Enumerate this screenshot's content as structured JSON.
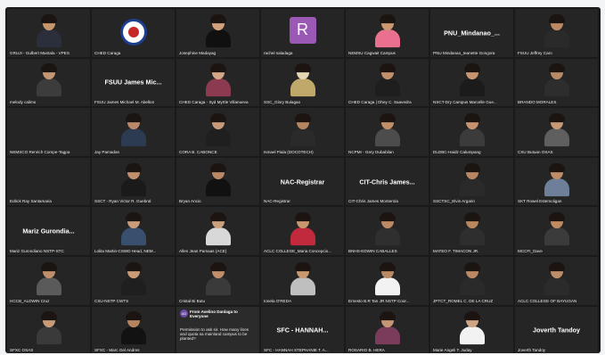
{
  "tiles": [
    {
      "name": "GRUJI - Gulbert Mantala - VPES",
      "bg": "#6a6d75",
      "skin": "#c8966c",
      "shirt": "#2b2f3b",
      "kind": "person"
    },
    {
      "name": "CHED Caraga",
      "kind": "logo"
    },
    {
      "name": "Josephine Madayag",
      "bg": "#d9dadf",
      "skin": "#d2a17c",
      "shirt": "#101010",
      "kind": "person"
    },
    {
      "name": "rachel saladaga",
      "kind": "letter",
      "letter": "R"
    },
    {
      "name": "NEMSU Cagwait Campus",
      "bg": "#8e7aa0",
      "skin": "#cb9871",
      "shirt": "#e9718f",
      "kind": "person"
    },
    {
      "name": "PNU Mindanao_Ieanette Gongora",
      "kind": "big",
      "big": "PNU_Mindanao_..."
    },
    {
      "name": "FSUU Jeffrey Caro",
      "bg": "#4a8f3d",
      "skin": "#bb8a64",
      "shirt": "#2a2a2a",
      "kind": "person"
    },
    {
      "name": "melody calimo",
      "bg": "#7b8dac",
      "skin": "#c49774",
      "shirt": "#3c3c3c",
      "kind": "person"
    },
    {
      "name": "FSUU James Michael M. Abellon",
      "kind": "big",
      "big": "FSUU James Mic..."
    },
    {
      "name": "CHED Caraga - Syd Myrtle Villanueva",
      "bg": "#e2d8c8",
      "skin": "#d4a786",
      "shirt": "#8b3a4f",
      "kind": "person"
    },
    {
      "name": "SSC_Glory Bulagao",
      "bg": "#66803b",
      "skin": "#e4d5b4",
      "shirt": "#c0a86a",
      "kind": "person"
    },
    {
      "name": "CHED Caraga | Dhey C. Saavedra",
      "bg": "#e4e4e4",
      "skin": "#c2906a",
      "shirt": "#1e1e1e",
      "kind": "person"
    },
    {
      "name": "NSCT-Dry Campus Marcelle Gue...",
      "bg": "#56a54e",
      "skin": "#c8956e",
      "shirt": "#1b1b1b",
      "kind": "person"
    },
    {
      "name": "BRANDO MORALES",
      "bg": "#dcdcdc",
      "skin": "#b98a66",
      "shirt": "#2d2d2d",
      "kind": "person"
    },
    {
      "name": "NEMSCO Renrich Compe-Tagpa",
      "kind": "black"
    },
    {
      "name": "Jay Pamadan",
      "bg": "#7b7f86",
      "skin": "#b9896a",
      "shirt": "#2c3a52",
      "kind": "person"
    },
    {
      "name": "CORA B. CABONCE",
      "bg": "#4d8f2f",
      "skin": "#c99a7a",
      "shirt": "#1f1f1f",
      "kind": "person"
    },
    {
      "name": "Ismael Piala (DOCOTECH)",
      "bg": "#c8a77b",
      "skin": "#b78460",
      "shirt": "#2a2a2a",
      "kind": "person"
    },
    {
      "name": "NCPMI - Gery Dubabilan",
      "bg": "#9a8b74",
      "skin": "#c08f68",
      "shirt": "#4c4c4c",
      "kind": "person"
    },
    {
      "name": "DLDBC-Haidz Calumpang",
      "bg": "#f1eeea",
      "skin": "#c7926d",
      "shirt": "#3b3b3b",
      "kind": "person"
    },
    {
      "name": "CSU Butuan OSAS",
      "bg": "#d7d3cf",
      "skin": "#c69a75",
      "shirt": "#5f5f5f",
      "kind": "person"
    },
    {
      "name": "Edrick Ray Santamaria",
      "kind": "black"
    },
    {
      "name": "SSCT - Ryan Victor R. Guebral",
      "bg": "#3a3a3a",
      "skin": "#c18f6d",
      "shirt": "#1a1a1a",
      "kind": "person"
    },
    {
      "name": "Bryan Ancio",
      "bg": "#cbbda9",
      "skin": "#ba8865",
      "shirt": "#111111",
      "kind": "person"
    },
    {
      "name": "NAC-Registrar",
      "kind": "big",
      "big": "NAC-Registrar"
    },
    {
      "name": "CIT-Chris James Monterola",
      "kind": "big",
      "big": "CIT-Chris James..."
    },
    {
      "name": "SSCTSC_Elvin Argarin",
      "bg": "#f2efec",
      "skin": "#b98661",
      "shirt": "#2a2a2a",
      "kind": "person"
    },
    {
      "name": "SKT Rowel Estemoligan",
      "bg": "#cfd6de",
      "skin": "#bf8c67",
      "shirt": "#6d7f99",
      "kind": "person"
    },
    {
      "name": "Mariz Gurondiano NSTP-STC",
      "kind": "big",
      "big": "Mariz  Gurondia..."
    },
    {
      "name": "Lolita Martin-CSWD Head, NEM...",
      "bg": "#9f9f9f",
      "skin": "#c79b7b",
      "shirt": "#38506e",
      "kind": "person"
    },
    {
      "name": "Allen Jean Pamaas (ACE)",
      "bg": "#8b2d2d",
      "skin": "#caa07f",
      "shirt": "#d8d8d8",
      "kind": "person"
    },
    {
      "name": "ACLC COLLEGE_Maria Concepcio...",
      "bg": "#d8d2c8",
      "skin": "#c8966f",
      "shirt": "#c12a3d",
      "kind": "person"
    },
    {
      "name": "BNHS-EDWIN CABALLES",
      "bg": "#e0dbd2",
      "skin": "#bb8a64",
      "shirt": "#2f2f2f",
      "kind": "person"
    },
    {
      "name": "MATEO F. TIMACON JR.",
      "bg": "#bfc8cf",
      "skin": "#b9875f",
      "shirt": "#2e2e2e",
      "kind": "person"
    },
    {
      "name": "MCCFI_Dave",
      "bg": "#dadada",
      "skin": "#bf8b63",
      "shirt": "#3b3b3b",
      "kind": "person"
    },
    {
      "name": "HCCB_ALDWIN Cruz",
      "bg": "#9f8f7a",
      "skin": "#c18e6a",
      "shirt": "#5a5a5a",
      "kind": "person"
    },
    {
      "name": "CSU-NSTP CWTS",
      "bg": "#d7cbbf",
      "skin": "#c99b77",
      "shirt": "#1f1f1f",
      "kind": "person"
    },
    {
      "name": "Cristal Bi Butu",
      "bg": "#cccccc",
      "skin": "#c08f6a",
      "shirt": "#3a3a3a",
      "kind": "person"
    },
    {
      "name": "Ionela O'REDA",
      "bg": "#c0283b",
      "skin": "#c8996f",
      "shirt": "#bfbfbf",
      "kind": "person"
    },
    {
      "name": "Ernesto B.R Tan JR NSTP Coor...",
      "bg": "#e9e6e1",
      "skin": "#b98865",
      "shirt": "#f2f2f2",
      "kind": "person"
    },
    {
      "name": "JPTCT_ROMEL C. DE LA CRUZ",
      "bg": "#4e9a45",
      "skin": "#bc8965",
      "shirt": "#2a2a2a",
      "kind": "person"
    },
    {
      "name": "ACLC COLLEGE OF BAYUGAN",
      "bg": "#c9a98d",
      "skin": "#bd8d6a",
      "shirt": "#2b2b2b",
      "kind": "person"
    },
    {
      "name": "SFXC OSAS",
      "bg": "#8aa7a4",
      "skin": "#c79a78",
      "shirt": "#3a3a3a",
      "kind": "person"
    },
    {
      "name": "SFXC - Marc Gel Andres",
      "bg": "#2f2f2f",
      "skin": "#b48460",
      "shirt": "#121212",
      "kind": "person"
    },
    {
      "name": "",
      "kind": "chat"
    },
    {
      "name": "SFC - HANNAH STEPHANIE T. A...",
      "kind": "big",
      "big": "SFC - HANNAH..."
    },
    {
      "name": "ROSARIO B. HERA",
      "bg": "#d8d3cb",
      "skin": "#c49674",
      "shirt": "#7b3b5a",
      "kind": "person"
    },
    {
      "name": "Marie Angeli T. Juday",
      "bg": "#e8d8cf",
      "skin": "#d0a583",
      "shirt": "#f2f2f2",
      "kind": "person"
    },
    {
      "name": "Joverth Tandoy",
      "kind": "big",
      "big": "Joverth Tandoy"
    }
  ],
  "chat": {
    "avatar_initials": "AD",
    "header": "From Avelino Danlaga to Everyone",
    "message": "Permission to ask sir. How many lines and quota sa mainland campus to be planted?"
  }
}
